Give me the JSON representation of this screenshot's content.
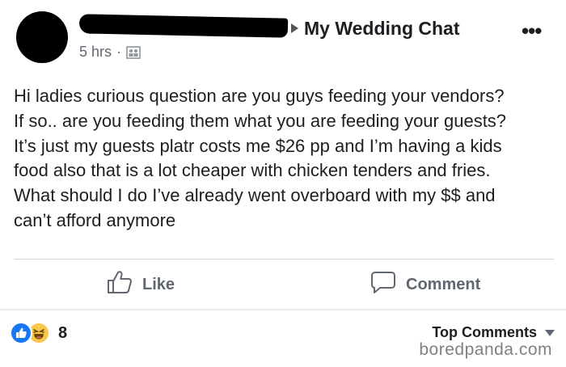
{
  "post": {
    "group_name": "My Wedding Chat",
    "more_label": "•••",
    "time": "5 hrs",
    "separator": "·",
    "text_lines": [
      "Hi ladies curious question are you guys feeding your vendors?",
      "If so.. are you feeding them what you are feeding your guests?",
      "It’s just my guests platr costs me $26 pp and I’m having a kids",
      "food also that is a lot cheaper with chicken tenders and fries.",
      "What should I do I’ve already went overboard with my $$ and",
      "can’t afford anymore"
    ]
  },
  "actions": {
    "like_label": "Like",
    "comment_label": "Comment"
  },
  "footer": {
    "reaction_count": "8",
    "top_comments_label": "Top Comments",
    "watermark": "boredpanda.com"
  },
  "colors": {
    "text": "#1c1e21",
    "secondary": "#606770",
    "like_blue": "#1877f2",
    "haha_yellow": "#f7c84b"
  },
  "icons": {
    "avatar": "redacted-avatar",
    "name": "redacted-name",
    "privacy": "group-members-icon",
    "like": "thumbs-up-icon",
    "comment": "speech-bubble-icon",
    "reaction_like": "like-reaction-icon",
    "reaction_haha": "haha-reaction-icon"
  }
}
